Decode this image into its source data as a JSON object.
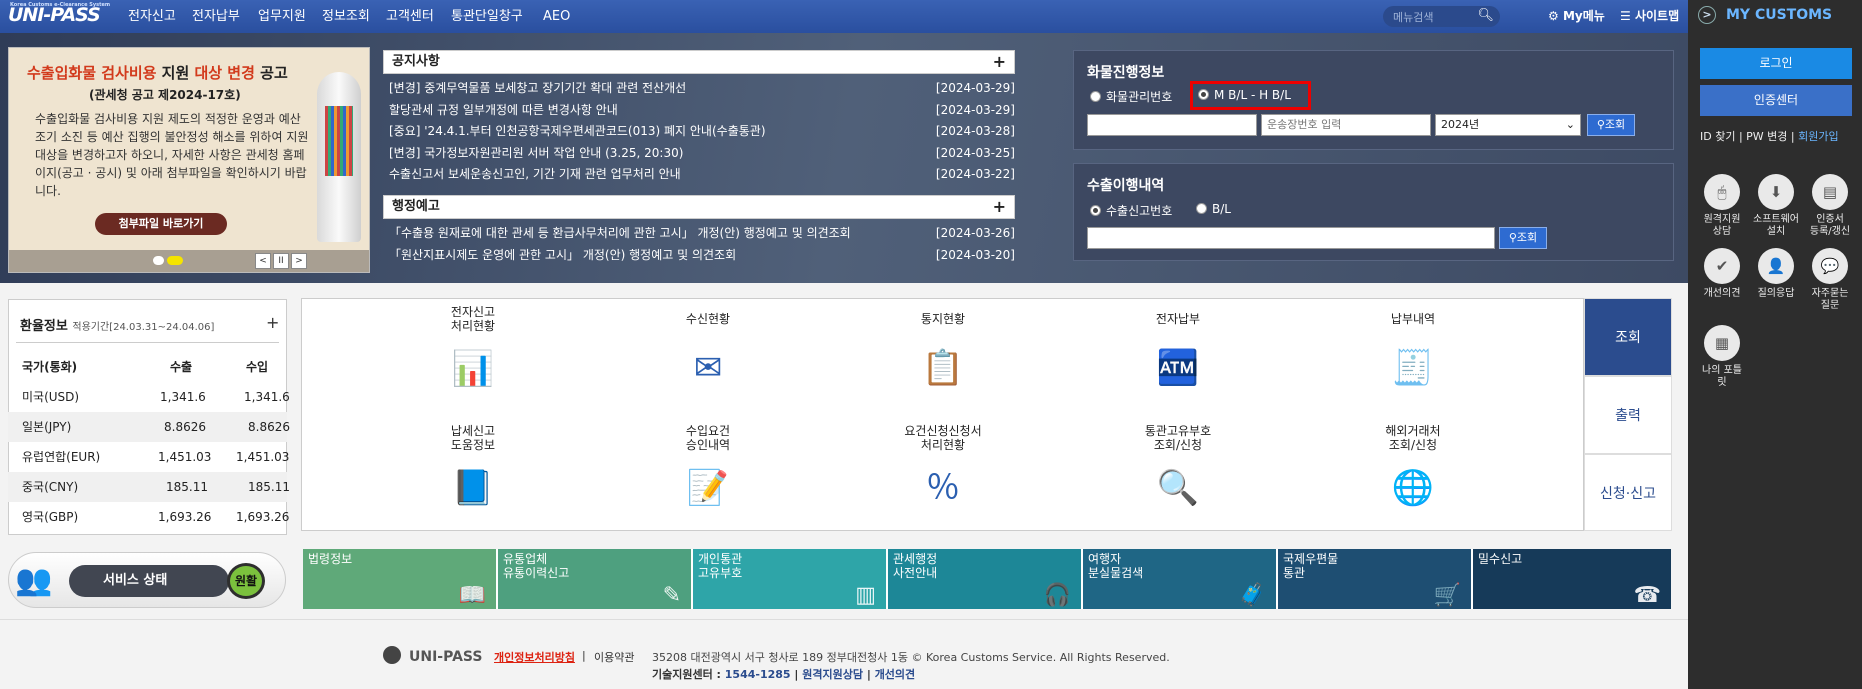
{
  "header": {
    "logo": "UNI-PASS",
    "logo_sub": "Korea Customs e-Clearance System",
    "nav": [
      "전자신고",
      "전자납부",
      "업무지원",
      "정보조회",
      "고객센터",
      "통관단일창구",
      "AEO"
    ],
    "search_placeholder": "메뉴검색",
    "my_menu": "My메뉴",
    "sitemap": "사이트맵"
  },
  "right_panel": {
    "title": "MY CUSTOMS",
    "login": "로그인",
    "cert_center": "인증센터",
    "id_find": "ID 찾기",
    "pw_change": "PW 변경",
    "join": "회원가입",
    "icons": [
      {
        "label": "원격지원\n상담",
        "icon": "remote-support-icon"
      },
      {
        "label": "소프트웨어\n설치",
        "icon": "software-install-icon"
      },
      {
        "label": "인증서\n등록/갱신",
        "icon": "certificate-icon"
      },
      {
        "label": "개선의견",
        "icon": "feedback-icon"
      },
      {
        "label": "질의응답",
        "icon": "qna-icon"
      },
      {
        "label": "자주묻는\n질문",
        "icon": "faq-icon"
      },
      {
        "label": "나의 포틀\n릿",
        "icon": "portlet-icon"
      }
    ]
  },
  "banner": {
    "title_red": "수출입화물 검사비용",
    "title_black": " 지원 ",
    "title_red2": "대상 변경",
    "title_end": " 공고",
    "subtitle": "(관세청 공고 제2024-17호)",
    "body": "수출입화물 검사비용 지원 제도의 적정한 운영과 예산 조기 소진 등 예산 집행의 불안정성 해소를 위하여 지원 대상을 변경하고자 하오니, 자세한 사항은 관세청 홈페이지(공고 · 공시) 및 아래 첨부파일을 확인하시기 바랍니다.",
    "button": "첨부파일 바로가기"
  },
  "notices": {
    "title": "공지사항",
    "items": [
      {
        "text": "[변경] 중계무역물품 보세창고 장기기간 확대 관련 전산개선",
        "date": "[2024-03-29]"
      },
      {
        "text": "할당관세 규정 일부개정에 따른 변경사항 안내",
        "date": "[2024-03-29]"
      },
      {
        "text": "[중요] '24.4.1.부터 인천공항국제우편세관코드(013) 폐지 안내(수출통관)",
        "date": "[2024-03-28]"
      },
      {
        "text": "[변경] 국가정보자원관리원 서버 작업 안내 (3.25, 20:30)",
        "date": "[2024-03-25]"
      },
      {
        "text": "수출신고서 보세운송신고인, 기간 기재 관련 업무처리 안내",
        "date": "[2024-03-22]"
      }
    ]
  },
  "admin_notices": {
    "title": "행정예고",
    "items": [
      {
        "text": "「수출용 원재료에 대한 관세 등 환급사무처리에 관한 고시」 개정(안) 행정예고 및 의견조회",
        "date": "[2024-03-26]"
      },
      {
        "text": "「원산지표시제도 운영에 관한 고시」 개정(안) 행정예고 및 의견조회",
        "date": "[2024-03-20]"
      }
    ]
  },
  "cargo": {
    "title": "화물진행정보",
    "radio1": "화물관리번호",
    "radio2": "M B/L - H B/L",
    "input2_placeholder": "운송장번호 입력",
    "year": "2024년",
    "search": "조회"
  },
  "export": {
    "title": "수출이행내역",
    "radio1": "수출신고번호",
    "radio2": "B/L",
    "search": "조회"
  },
  "fx": {
    "title": "환율정보",
    "period": "적용기간[24.03.31~24.04.06]",
    "headers": [
      "국가(통화)",
      "수출",
      "수입"
    ],
    "rows": [
      [
        "미국(USD)",
        "1,341.6",
        "1,341.6"
      ],
      [
        "일본(JPY)",
        "8.8626",
        "8.8626"
      ],
      [
        "유럽연합(EUR)",
        "1,451.03",
        "1,451.03"
      ],
      [
        "중국(CNY)",
        "185.11",
        "185.11"
      ],
      [
        "영국(GBP)",
        "1,693.26",
        "1,693.26"
      ]
    ]
  },
  "service": {
    "label": "서비스 상태",
    "status": "원활"
  },
  "grid": [
    {
      "label": "전자신고\n처리현황",
      "icon": "bar-chart-icon"
    },
    {
      "label": "수신현황",
      "icon": "mail-monitor-icon"
    },
    {
      "label": "통지현황",
      "icon": "notice-doc-icon"
    },
    {
      "label": "전자납부",
      "icon": "atm-icon"
    },
    {
      "label": "납부내역",
      "icon": "receipt-icon"
    },
    {
      "label": "납세신고\n도움정보",
      "icon": "help-book-icon"
    },
    {
      "label": "수입요건\n승인내역",
      "icon": "import-doc-icon"
    },
    {
      "label": "요건신청신청서\n처리현황",
      "icon": "percent-doc-icon"
    },
    {
      "label": "통관고유부호\n조회/신청",
      "icon": "barcode-person-icon"
    },
    {
      "label": "해외거래처\n조회/신청",
      "icon": "globe-search-icon"
    }
  ],
  "side_tabs": [
    "조회",
    "출력",
    "신청·신고"
  ],
  "quick": [
    {
      "label": "법령정보",
      "color": "#5fa979",
      "icon": "book-icon"
    },
    {
      "label": "유통업체\n유통이력신고",
      "color": "#4ea07f",
      "icon": "pen-icon"
    },
    {
      "label": "개인통관\n고유부호",
      "color": "#2ea5a8",
      "icon": "barcode-icon"
    },
    {
      "label": "관세행정\n사전안내",
      "color": "#1d8797",
      "icon": "headset-icon"
    },
    {
      "label": "여행자\n분실물검색",
      "color": "#1f6685",
      "icon": "luggage-icon"
    },
    {
      "label": "국제우편물\n통관",
      "color": "#1e4e72",
      "icon": "cart-icon"
    },
    {
      "label": "밀수신고",
      "color": "#163a59",
      "icon": "phone-24h-icon"
    }
  ],
  "footer": {
    "logo": "UNI-PASS",
    "privacy": "개인정보처리방침",
    "terms": "이용약관",
    "address": "35208 대전광역시 서구 청사로 189 정부대전청사 1동 © Korea Customs Service. All Rights Reserved.",
    "tech_label": "기술지원센터 : ",
    "tech_phone": "1544-1285",
    "remote": "원격지원상담",
    "improve": "개선의견"
  }
}
